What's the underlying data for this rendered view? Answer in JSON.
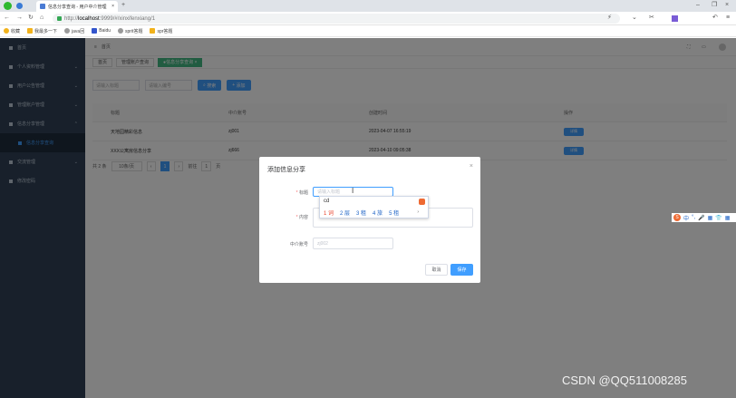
{
  "browser": {
    "tab_title": "信息分享查询 - 用户中介管理",
    "new_tab": "+",
    "url_scheme": "http://",
    "url_host": "localhost",
    "url_rest": ":9999/#/xinxifenxiang/1",
    "bookmarks": [
      "收藏",
      "我最多一下",
      "java回",
      "Baidu",
      "sprit答题",
      "spr答题"
    ]
  },
  "sidebar": {
    "items": [
      {
        "label": "首页"
      },
      {
        "label": "个人资料管理"
      },
      {
        "label": "用户公告管理"
      },
      {
        "label": "管理账户管理"
      },
      {
        "label": "信息分享管理"
      },
      {
        "label": "信息分享查询"
      },
      {
        "label": "交流管理"
      },
      {
        "label": "修改密码"
      }
    ]
  },
  "navbar": {
    "breadcrumb": "首页"
  },
  "tags": [
    "首页",
    "管理账户查询",
    "信息分享查询"
  ],
  "search": {
    "title_placeholder": "请输入标题",
    "number_placeholder": "请输入编号",
    "search_btn": "搜索",
    "add_btn": "添加"
  },
  "table": {
    "headers": [
      "标题",
      "中介账号",
      "创建时间",
      "操作"
    ],
    "rows": [
      {
        "title": "天地园精彩信息",
        "account": "zj001",
        "time": "2023-04-07 16:55:19",
        "op": "详情"
      },
      {
        "title": "XXX公寓房信息分享",
        "account": "zj666",
        "time": "2023-04-10 09:05:38",
        "op": "详情"
      }
    ]
  },
  "pagination": {
    "total": "共 2 条",
    "page_size": "10条/页",
    "current": "1",
    "goto_label": "前往",
    "goto_value": "1",
    "goto_suffix": "页"
  },
  "dialog": {
    "title": "添加信息分享",
    "close": "×",
    "title_label": "标题",
    "title_placeholder": "请输入标题",
    "content_label": "内容",
    "account_label": "中介账号",
    "account_value": "zj002",
    "cancel": "取消",
    "confirm": "保存"
  },
  "ime": {
    "typed": "cd",
    "candidates": [
      "1 词",
      "2 层",
      "3 租",
      "4 旅",
      "5 租"
    ],
    "more": "›"
  },
  "imebar": {
    "logo": "S",
    "items": [
      "中",
      "°,",
      "🎤",
      "▦",
      "👕",
      "▦"
    ]
  },
  "watermark": "CSDN @QQ511008285",
  "colors": {
    "primary": "#409eff",
    "sidebar": "#304156",
    "success": "#42b983"
  }
}
